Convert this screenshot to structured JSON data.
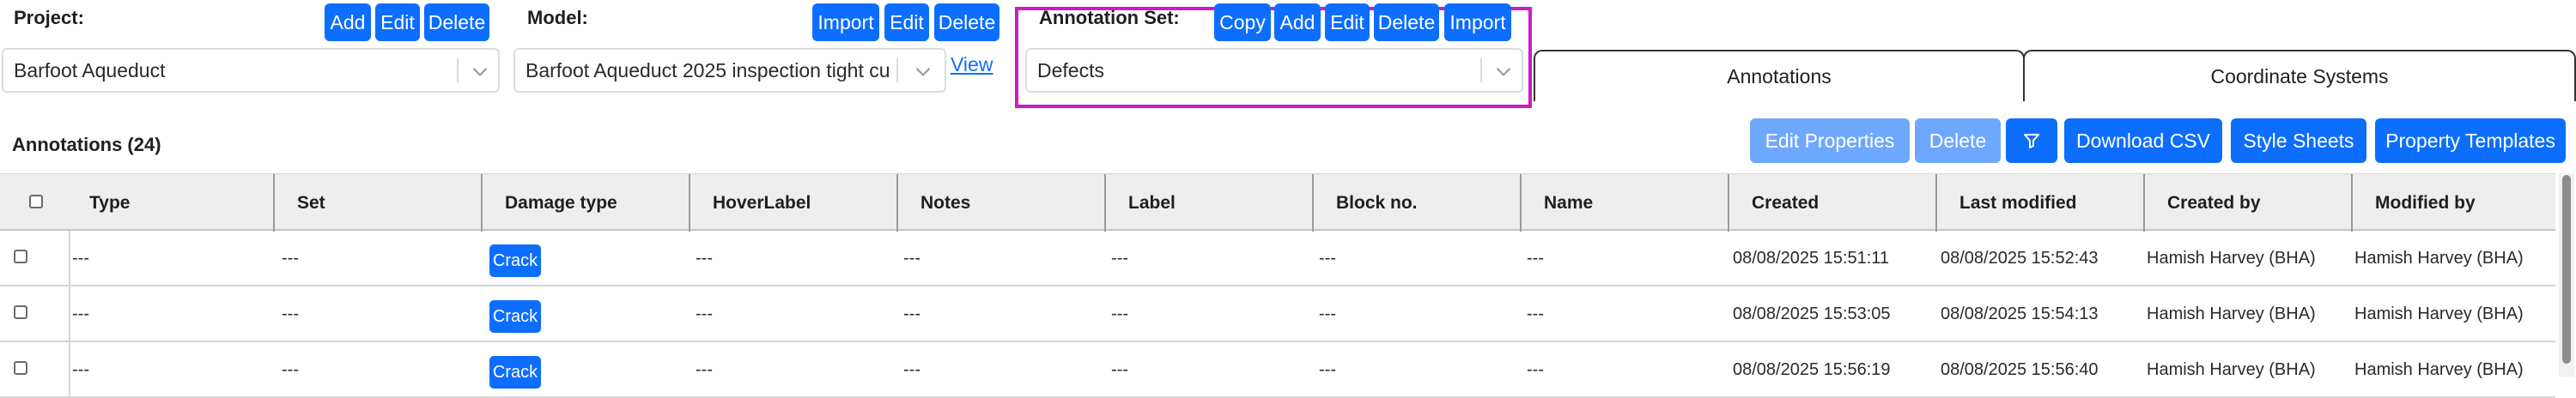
{
  "project": {
    "label": "Project:",
    "buttons": [
      "Add",
      "Edit",
      "Delete"
    ],
    "selected": "Barfoot Aqueduct"
  },
  "model": {
    "label": "Model:",
    "buttons": [
      "Import",
      "Edit",
      "Delete"
    ],
    "selected": "Barfoot Aqueduct 2025 inspection tight cu",
    "view_link": "View"
  },
  "annotation_set": {
    "label": "Annotation Set:",
    "buttons": [
      "Copy",
      "Add",
      "Edit",
      "Delete",
      "Import"
    ],
    "selected": "Defects",
    "highlight_color": "#d01bc2"
  },
  "tabs": [
    "Annotations",
    "Coordinate Systems"
  ],
  "toolbar": {
    "title": "Annotations (24)",
    "edit_properties": "Edit Properties",
    "delete": "Delete",
    "filter_icon": "filter-icon",
    "download_csv": "Download CSV",
    "style_sheets": "Style Sheets",
    "property_templates": "Property Templates"
  },
  "table": {
    "columns": [
      "Type",
      "Set",
      "Damage type",
      "HoverLabel",
      "Notes",
      "Label",
      "Block no.",
      "Name",
      "Created",
      "Last modified",
      "Created by",
      "Modified by"
    ],
    "rows": [
      {
        "type": "---",
        "set": "---",
        "damage": "Crack",
        "hover": "---",
        "notes": "---",
        "label": "---",
        "block": "---",
        "name": "---",
        "created": "08/08/2025 15:51:11",
        "modified": "08/08/2025 15:52:43",
        "created_by": "Hamish Harvey (BHA)",
        "modified_by": "Hamish Harvey (BHA)"
      },
      {
        "type": "---",
        "set": "---",
        "damage": "Crack",
        "hover": "---",
        "notes": "---",
        "label": "---",
        "block": "---",
        "name": "---",
        "created": "08/08/2025 15:53:05",
        "modified": "08/08/2025 15:54:13",
        "created_by": "Hamish Harvey (BHA)",
        "modified_by": "Hamish Harvey (BHA)"
      },
      {
        "type": "---",
        "set": "---",
        "damage": "Crack",
        "hover": "---",
        "notes": "---",
        "label": "---",
        "block": "---",
        "name": "---",
        "created": "08/08/2025 15:56:19",
        "modified": "08/08/2025 15:56:40",
        "created_by": "Hamish Harvey (BHA)",
        "modified_by": "Hamish Harvey (BHA)"
      }
    ]
  },
  "colors": {
    "primary": "#0d6efd",
    "primary_disabled": "#6ea8fe",
    "header_bg": "#eeeeee"
  }
}
